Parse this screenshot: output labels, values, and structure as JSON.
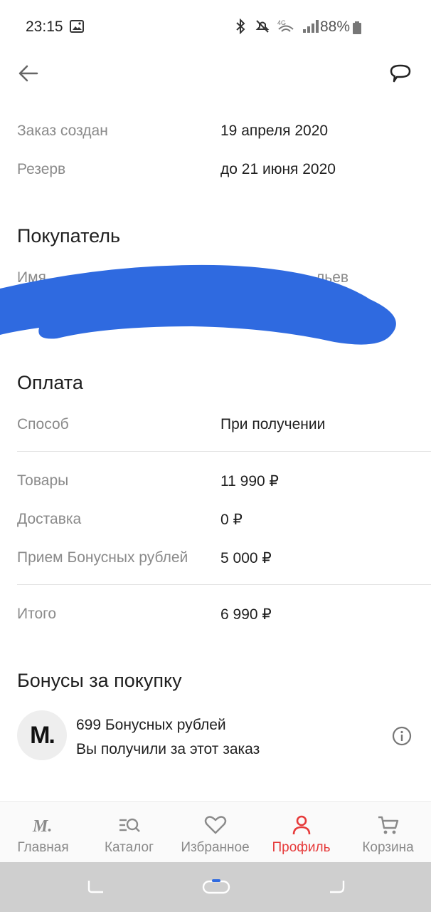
{
  "status_bar": {
    "time": "23:15",
    "battery": "88%"
  },
  "top_bar": {
    "back_icon": "arrow-left-icon",
    "chat_icon": "chat-bubble-icon"
  },
  "order_info": {
    "created_label": "Заказ создан",
    "created_value": "19 апреля 2020",
    "reserve_label": "Резерв",
    "reserve_value": "до 21 июня 2020"
  },
  "buyer": {
    "title": "Покупатель",
    "name_label": "Имя",
    "name_value_fragment": "льев"
  },
  "payment": {
    "title": "Оплата",
    "method_label": "Способ",
    "method_value": "При получении",
    "goods_label": "Товары",
    "goods_value": "11 990 ₽",
    "delivery_label": "Доставка",
    "delivery_value": "0 ₽",
    "bonus_label": "Прием Бонусных рублей",
    "bonus_value": "5 000 ₽",
    "total_label": "Итого",
    "total_value": "6 990 ₽"
  },
  "bonuses": {
    "title": "Бонусы за покупку",
    "logo_text": "M.",
    "amount": "699 Бонусных рублей",
    "description": "Вы получили за этот заказ"
  },
  "bottom_nav": {
    "items": [
      {
        "label": "Главная",
        "icon": "m-logo-icon"
      },
      {
        "label": "Каталог",
        "icon": "catalog-search-icon"
      },
      {
        "label": "Избранное",
        "icon": "heart-icon"
      },
      {
        "label": "Профиль",
        "icon": "person-icon",
        "active": true
      },
      {
        "label": "Корзина",
        "icon": "cart-icon"
      }
    ]
  },
  "colors": {
    "accent": "#e63a3a",
    "scribble": "#2f6ae0"
  }
}
